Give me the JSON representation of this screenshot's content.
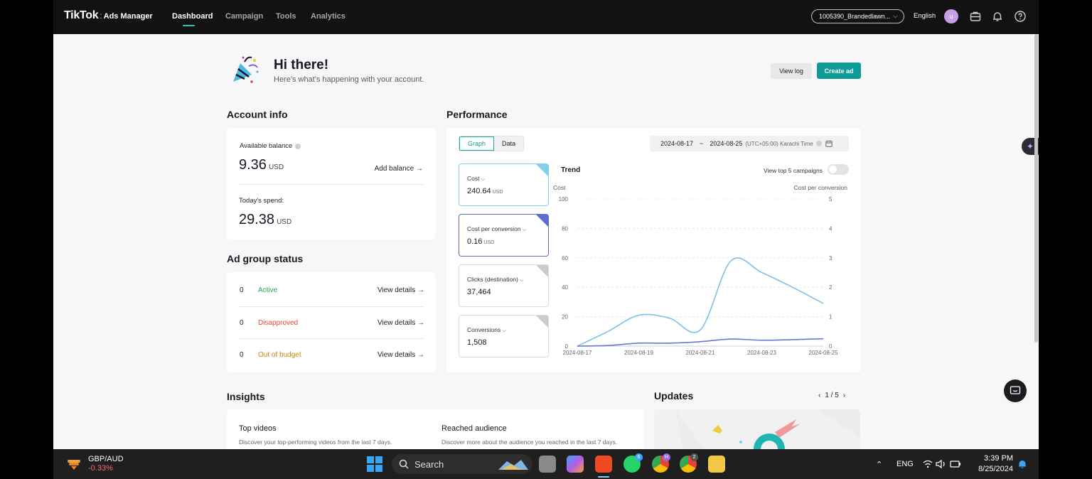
{
  "nav": {
    "logo_main": "TikTok",
    "logo_sep": ":",
    "logo_sub": "Ads Manager",
    "tabs": [
      {
        "label": "Dashboard",
        "active": true
      },
      {
        "label": "Campaign",
        "active": false
      },
      {
        "label": "Tools",
        "active": false
      },
      {
        "label": "Analytics",
        "active": false
      }
    ],
    "account": "1005390_Brandedlawn...",
    "language": "English",
    "avatar_letter": "u",
    "icons": [
      "briefcase-icon",
      "bell-icon",
      "help-icon"
    ]
  },
  "hero": {
    "title": "Hi there!",
    "subtitle": "Here's what's happening with your account.",
    "view_log": "View log",
    "create_ad": "Create ad"
  },
  "account_info": {
    "title": "Account info",
    "balance_label": "Available balance",
    "balance_value": "9.36",
    "balance_unit": "USD",
    "add_balance": "Add balance →",
    "spend_label": "Today's spend:",
    "spend_value": "29.38",
    "spend_unit": "USD"
  },
  "ad_group_status": {
    "title": "Ad group status",
    "rows": [
      {
        "count": "0",
        "label": "Active",
        "color": "#2fa54e",
        "action": "View details →"
      },
      {
        "count": "0",
        "label": "Disapproved",
        "color": "#e0483a",
        "action": "View details →"
      },
      {
        "count": "0",
        "label": "Out of budget",
        "color": "#c8850d",
        "action": "View details →"
      }
    ]
  },
  "performance": {
    "title": "Performance",
    "tab_graph": "Graph",
    "tab_data": "Data",
    "date_start": "2024-08-17",
    "date_sep": "~",
    "date_end": "2024-08-25",
    "timezone": "(UTC+05:00) Karachi Time",
    "metrics": [
      {
        "label": "Cost",
        "value": "240.64",
        "unit": "USD",
        "corner": "#7fd0e8"
      },
      {
        "label": "Cost per conversion",
        "value": "0.16",
        "unit": "USD",
        "corner": "#5b6dd0"
      },
      {
        "label": "Clicks (destination)",
        "value": "37,464",
        "unit": "",
        "corner": "#cccccc"
      },
      {
        "label": "Conversions",
        "value": "1,508",
        "unit": "",
        "corner": "#cccccc"
      }
    ],
    "trend_title": "Trend",
    "top5_label": "View top 5 campaigns"
  },
  "chart_data": {
    "type": "line",
    "x": [
      "2024-08-17",
      "2024-08-18",
      "2024-08-19",
      "2024-08-20",
      "2024-08-21",
      "2024-08-22",
      "2024-08-23",
      "2024-08-24",
      "2024-08-25"
    ],
    "x_tick_labels": [
      "2024-08-17",
      "2024-08-19",
      "2024-08-21",
      "2024-08-23",
      "2024-08-25"
    ],
    "left_axis": {
      "label": "Cost",
      "ylim": [
        0,
        100
      ],
      "ticks": [
        0,
        20,
        40,
        60,
        80,
        100
      ]
    },
    "right_axis": {
      "label": "Cost per conversion",
      "ylim": [
        0,
        5
      ],
      "ticks": [
        0,
        1,
        2,
        3,
        4,
        5
      ]
    },
    "series": [
      {
        "axis": "left",
        "color": "#7cc0e8",
        "values": [
          0,
          10,
          21,
          19,
          11,
          58,
          50,
          40,
          29
        ]
      },
      {
        "axis": "right",
        "color": "#6a78d1",
        "values": [
          0,
          0.02,
          0.1,
          0.1,
          0.15,
          0.24,
          0.2,
          0.22,
          0.25
        ]
      }
    ],
    "grid": true
  },
  "insights": {
    "title": "Insights",
    "col1_title": "Top videos",
    "col1_desc": "Discover your top-performing videos from the last 7 days.",
    "col2_title": "Reached audience",
    "col2_desc": "Discover more about the audience you reached in the last 7 days."
  },
  "updates": {
    "title": "Updates",
    "pager": "1 / 5"
  },
  "taskbar": {
    "ticker_name": "GBP/AUD",
    "ticker_change": "-0.33%",
    "search": "Search",
    "lang": "ENG",
    "time": "3:39 PM",
    "date": "8/25/2024",
    "badge_whatsapp": "6",
    "badge_chrome1": "H",
    "badge_chrome2": "2"
  }
}
